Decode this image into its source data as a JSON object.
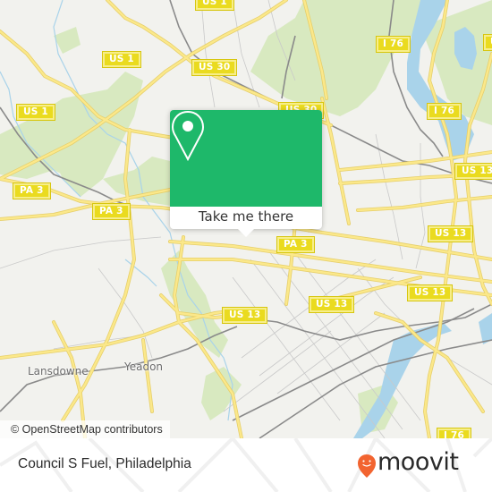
{
  "map": {
    "shields": [
      {
        "id": "us1-top",
        "label": "US 1"
      },
      {
        "id": "us1-a",
        "label": "US 1"
      },
      {
        "id": "us1-b",
        "label": "US 1"
      },
      {
        "id": "us30-a",
        "label": "US 30"
      },
      {
        "id": "us30-b",
        "label": "US 30"
      },
      {
        "id": "i76-a",
        "label": "I 76"
      },
      {
        "id": "i76-b",
        "label": "I 76"
      },
      {
        "id": "i76-c",
        "label": "I 76"
      },
      {
        "id": "us13-a",
        "label": "US 13"
      },
      {
        "id": "us13-b",
        "label": "US 13"
      },
      {
        "id": "us13-c",
        "label": "US 13"
      },
      {
        "id": "us13-d",
        "label": "US 13"
      },
      {
        "id": "us13-e",
        "label": "US 13"
      },
      {
        "id": "us-edge",
        "label": "U"
      },
      {
        "id": "pa3-a",
        "label": "PA 3"
      },
      {
        "id": "pa3-b",
        "label": "PA 3"
      },
      {
        "id": "pa3-c",
        "label": "PA 3"
      }
    ],
    "places": [
      {
        "label": "Lansdowne"
      },
      {
        "label": "Yeadon"
      }
    ],
    "attribution": "© OpenStreetMap contributors"
  },
  "popup": {
    "icon": "location-pin-icon",
    "action_label": "Take me there",
    "color": "#1eb86a"
  },
  "footer": {
    "title": "Council S Fuel, Philadelphia",
    "brand": "moovit",
    "brand_color": "#f26430"
  }
}
